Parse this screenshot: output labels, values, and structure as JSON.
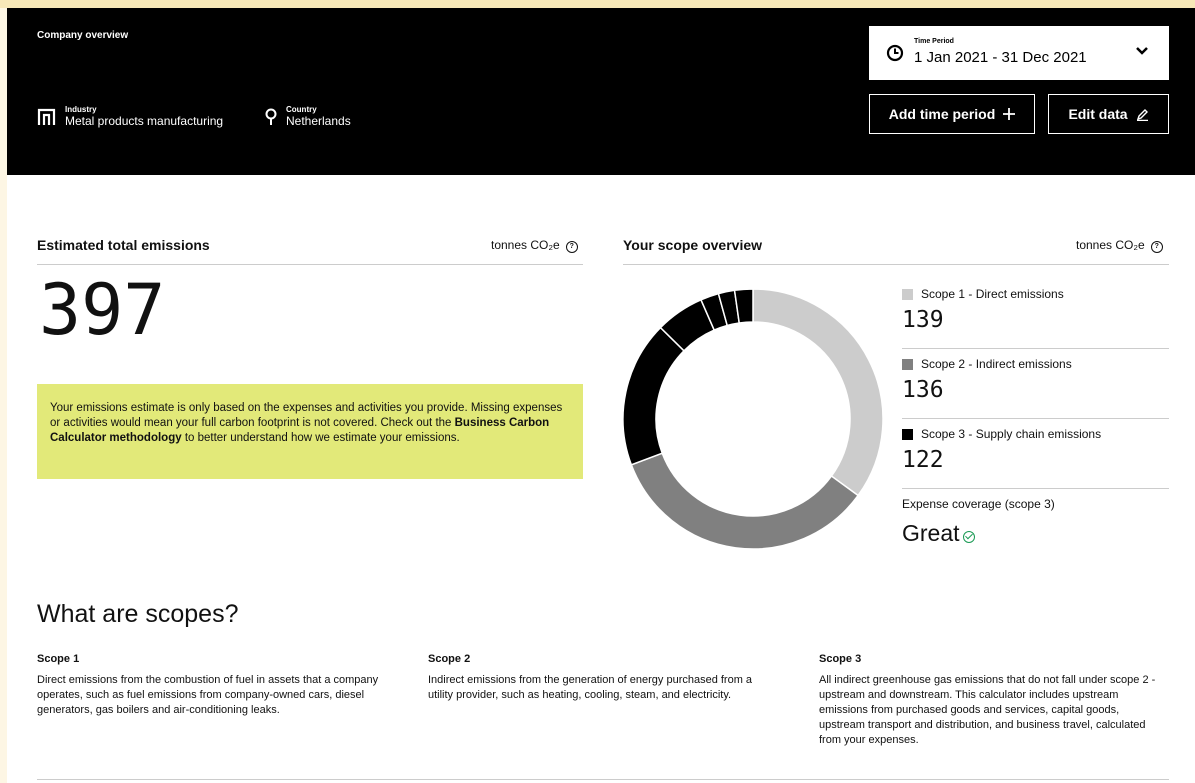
{
  "header": {
    "company_overview": "Company overview",
    "industry_label": "Industry",
    "industry_value": "Metal products manufacturing",
    "country_label": "Country",
    "country_value": "Netherlands",
    "time_period_label": "Time Period",
    "time_period_value": "1 Jan 2021 - 31 Dec 2021",
    "add_time_period_label": "Add time period",
    "edit_data_label": "Edit data"
  },
  "totals": {
    "title": "Estimated total emissions",
    "unit": "tonnes CO₂e",
    "value": "397",
    "note_part1": "Your emissions estimate is only based on the expenses and activities you provide. Missing expenses or activities would mean your full carbon footprint is not covered. Check out the ",
    "note_link": "Business Carbon Calculator methodology",
    "note_part2": " to better understand how we estimate your emissions."
  },
  "scope_overview": {
    "title": "Your scope overview",
    "unit": "tonnes CO₂e",
    "colors": {
      "scope1": "#cccccc",
      "scope2": "#808080",
      "scope3": "#000000"
    },
    "scopes": [
      {
        "label": "Scope 1 - Direct emissions",
        "value": "139"
      },
      {
        "label": "Scope 2 - Indirect emissions",
        "value": "136"
      },
      {
        "label": "Scope 3 - Supply chain emissions",
        "value": "122"
      }
    ],
    "scope3_breakdown": [
      72,
      24,
      9,
      8,
      9
    ],
    "coverage_label": "Expense coverage (scope 3)",
    "coverage_value": "Great"
  },
  "what_are_scopes": {
    "title": "What are scopes?",
    "items": [
      {
        "heading": "Scope 1",
        "text": "Direct emissions from the combustion of fuel in assets that a company operates, such as fuel emissions from company-owned cars, diesel generators, gas boilers and air-conditioning leaks."
      },
      {
        "heading": "Scope 2",
        "text": "Indirect emissions from the generation of energy purchased from a utility provider, such as heating, cooling, steam, and electricity."
      },
      {
        "heading": "Scope 3",
        "text": "All indirect greenhouse gas emissions that do not fall under scope 2 - upstream and downstream. This calculator includes upstream emissions from purchased goods and services, capital goods, upstream transport and distribution, and business travel, calculated from your expenses."
      }
    ]
  }
}
